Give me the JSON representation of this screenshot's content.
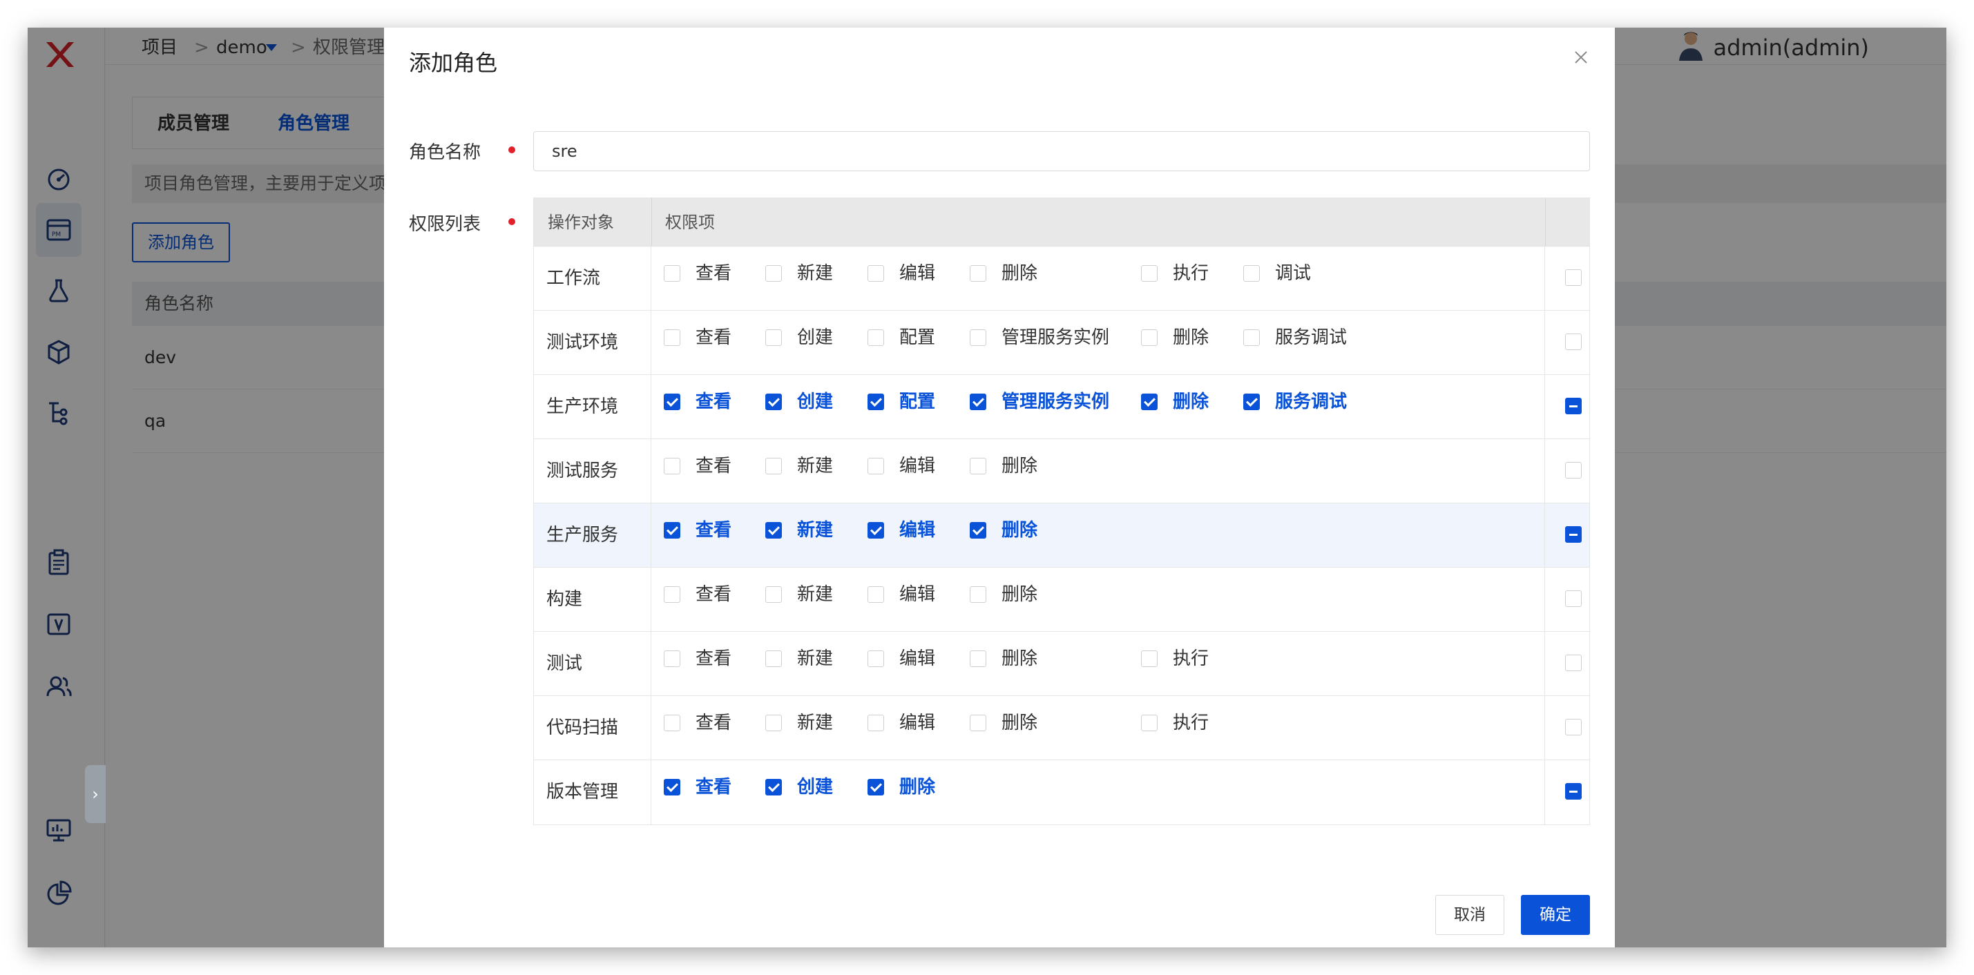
{
  "breadcrumb": {
    "project": "项目",
    "sep": ">",
    "demo": "demo",
    "current": "权限管理"
  },
  "user": {
    "name": "admin(admin)"
  },
  "page": {
    "tabs": [
      "成员管理",
      "角色管理"
    ],
    "description": "项目角色管理，主要用于定义项",
    "add_role_button": "添加角色",
    "table_header": "角色名称",
    "roles": [
      "dev",
      "qa"
    ]
  },
  "modal": {
    "title": "添加角色",
    "role_name_label": "角色名称",
    "role_name_value": "sre",
    "perm_list_label": "权限列表",
    "col_object": "操作对象",
    "col_perms": "权限项",
    "cancel": "取消",
    "confirm": "确定",
    "rows": [
      {
        "object": "工作流",
        "perms": [
          {
            "label": "查看",
            "checked": false
          },
          {
            "label": "新建",
            "checked": false
          },
          {
            "label": "编辑",
            "checked": false
          },
          {
            "label": "删除",
            "checked": false
          },
          {
            "label": "执行",
            "checked": false
          },
          {
            "label": "调试",
            "checked": false
          }
        ],
        "state": "none"
      },
      {
        "object": "测试环境",
        "perms": [
          {
            "label": "查看",
            "checked": false
          },
          {
            "label": "创建",
            "checked": false
          },
          {
            "label": "配置",
            "checked": false
          },
          {
            "label": "管理服务实例",
            "checked": false
          },
          {
            "label": "删除",
            "checked": false
          },
          {
            "label": "服务调试",
            "checked": false
          }
        ],
        "state": "none"
      },
      {
        "object": "生产环境",
        "perms": [
          {
            "label": "查看",
            "checked": true
          },
          {
            "label": "创建",
            "checked": true
          },
          {
            "label": "配置",
            "checked": true
          },
          {
            "label": "管理服务实例",
            "checked": true
          },
          {
            "label": "删除",
            "checked": true
          },
          {
            "label": "服务调试",
            "checked": true
          }
        ],
        "state": "indeterminate"
      },
      {
        "object": "测试服务",
        "perms": [
          {
            "label": "查看",
            "checked": false
          },
          {
            "label": "新建",
            "checked": false
          },
          {
            "label": "编辑",
            "checked": false
          },
          {
            "label": "删除",
            "checked": false
          }
        ],
        "state": "none"
      },
      {
        "object": "生产服务",
        "perms": [
          {
            "label": "查看",
            "checked": true
          },
          {
            "label": "新建",
            "checked": true
          },
          {
            "label": "编辑",
            "checked": true
          },
          {
            "label": "删除",
            "checked": true
          }
        ],
        "state": "indeterminate",
        "highlighted": true
      },
      {
        "object": "构建",
        "perms": [
          {
            "label": "查看",
            "checked": false
          },
          {
            "label": "新建",
            "checked": false
          },
          {
            "label": "编辑",
            "checked": false
          },
          {
            "label": "删除",
            "checked": false
          }
        ],
        "state": "none"
      },
      {
        "object": "测试",
        "perms": [
          {
            "label": "查看",
            "checked": false
          },
          {
            "label": "新建",
            "checked": false
          },
          {
            "label": "编辑",
            "checked": false
          },
          {
            "label": "删除",
            "checked": false
          },
          {
            "label": "执行",
            "checked": false
          }
        ],
        "state": "none"
      },
      {
        "object": "代码扫描",
        "perms": [
          {
            "label": "查看",
            "checked": false
          },
          {
            "label": "新建",
            "checked": false
          },
          {
            "label": "编辑",
            "checked": false
          },
          {
            "label": "删除",
            "checked": false
          },
          {
            "label": "执行",
            "checked": false
          }
        ],
        "state": "none"
      },
      {
        "object": "版本管理",
        "perms": [
          {
            "label": "查看",
            "checked": true
          },
          {
            "label": "创建",
            "checked": true
          },
          {
            "label": "删除",
            "checked": true
          }
        ],
        "state": "indeterminate"
      }
    ]
  },
  "colors": {
    "accent": "#0a53d8",
    "required": "#e3202a",
    "overlay": "rgba(0,0,0,0.46)"
  },
  "icons": [
    "logo-x-icon",
    "dashboard-icon",
    "project-icon",
    "testing-flask-icon",
    "delivery-box-icon",
    "workflow-tree-icon",
    "clipboard-icon",
    "version-icon",
    "team-icon",
    "monitor-icon",
    "pie-chart-icon",
    "close-icon",
    "chevron-right-icon",
    "caret-down-icon"
  ]
}
